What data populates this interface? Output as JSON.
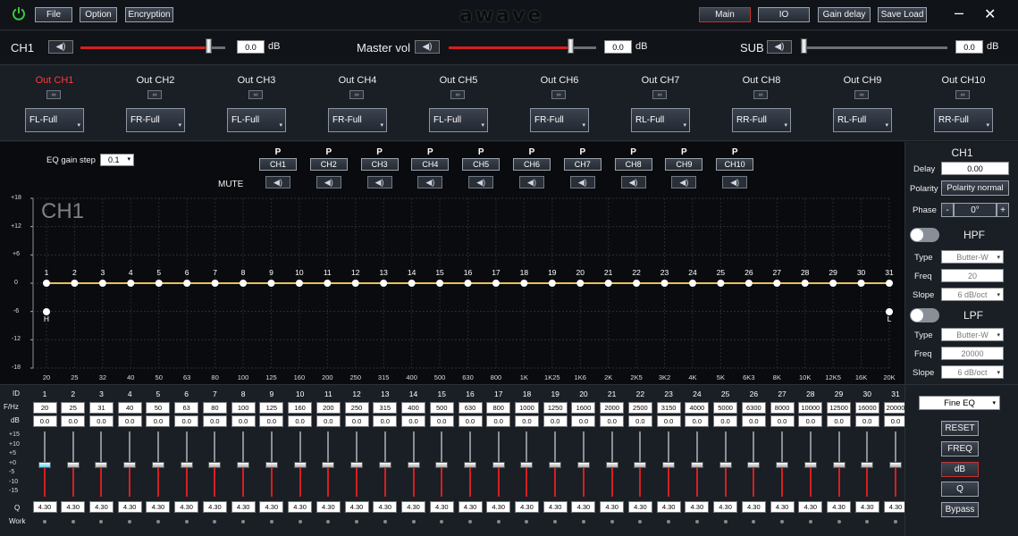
{
  "app": {
    "logo": "awave"
  },
  "menu": {
    "file": "File",
    "option": "Option",
    "encryption": "Encryption"
  },
  "nav": {
    "main": "Main",
    "io": "IO",
    "gain_delay": "Gain delay",
    "save_load": "Save Load"
  },
  "window": {
    "minimize": "–",
    "close": "✕"
  },
  "volume": {
    "ch1": {
      "label": "CH1",
      "value": "0.0",
      "unit": "dB",
      "level": 0.9
    },
    "master": {
      "label": "Master vol",
      "value": "0.0",
      "unit": "dB",
      "level": 0.84
    },
    "sub": {
      "label": "SUB",
      "value": "0.0",
      "unit": "dB",
      "level": 0.0
    }
  },
  "outputs": [
    {
      "label": "Out CH1",
      "mode": "FL-Full"
    },
    {
      "label": "Out CH2",
      "mode": "FR-Full"
    },
    {
      "label": "Out CH3",
      "mode": "FL-Full"
    },
    {
      "label": "Out CH4",
      "mode": "FR-Full"
    },
    {
      "label": "Out CH5",
      "mode": "FL-Full"
    },
    {
      "label": "Out CH6",
      "mode": "FR-Full"
    },
    {
      "label": "Out CH7",
      "mode": "RL-Full"
    },
    {
      "label": "Out CH8",
      "mode": "RR-Full"
    },
    {
      "label": "Out CH9",
      "mode": "RL-Full"
    },
    {
      "label": "Out CH10",
      "mode": "RR-Full"
    }
  ],
  "eq_settings": {
    "gain_step_label": "EQ gain step",
    "gain_step_value": "0.1",
    "mute_label": "MUTE",
    "phase_marker": "P"
  },
  "channel_buttons": [
    "CH1",
    "CH2",
    "CH3",
    "CH4",
    "CH5",
    "CH6",
    "CH7",
    "CH8",
    "CH9",
    "CH10"
  ],
  "graph": {
    "channel_title": "CH1",
    "y_ticks": [
      "+18",
      "+12",
      "+6",
      "0",
      "-6",
      "-12",
      "-18"
    ],
    "x_ticks": [
      "20",
      "25",
      "32",
      "40",
      "50",
      "63",
      "80",
      "100",
      "125",
      "160",
      "200",
      "250",
      "315",
      "400",
      "500",
      "630",
      "800",
      "1K",
      "1K25",
      "1K6",
      "2K",
      "2K5",
      "3K2",
      "4K",
      "5K",
      "6K3",
      "8K",
      "10K",
      "12K5",
      "16K",
      "20K"
    ],
    "hpf_marker": "H",
    "lpf_marker": "L",
    "line_color": "#e8c060"
  },
  "right_panel": {
    "title": "CH1",
    "delay_label": "Delay",
    "delay_value": "0.00",
    "polarity_label": "Polarity",
    "polarity_value": "Polarity normal",
    "phase_label": "Phase",
    "phase_minus": "-",
    "phase_value": "0°",
    "phase_plus": "+",
    "hpf": {
      "title": "HPF",
      "type_label": "Type",
      "type_value": "Butter-W",
      "freq_label": "Freq",
      "freq_value": "20",
      "slope_label": "Slope",
      "slope_value": "6 dB/oct"
    },
    "lpf": {
      "title": "LPF",
      "type_label": "Type",
      "type_value": "Butter-W",
      "freq_label": "Freq",
      "freq_value": "20000",
      "slope_label": "Slope",
      "slope_value": "6 dB/oct"
    }
  },
  "bands": {
    "row_labels": {
      "id": "ID",
      "freq": "F/Hz",
      "db": "dB",
      "q": "Q",
      "work": "Work"
    },
    "fader_scale": [
      "+15",
      "+10",
      "+5",
      "+0",
      "-5",
      "-10",
      "-15"
    ],
    "ids": [
      "1",
      "2",
      "3",
      "4",
      "5",
      "6",
      "7",
      "8",
      "9",
      "10",
      "11",
      "12",
      "13",
      "14",
      "15",
      "16",
      "17",
      "18",
      "19",
      "20",
      "21",
      "22",
      "23",
      "24",
      "25",
      "26",
      "27",
      "28",
      "29",
      "30",
      "31"
    ],
    "freqs": [
      "20",
      "25",
      "31",
      "40",
      "50",
      "63",
      "80",
      "100",
      "125",
      "160",
      "200",
      "250",
      "315",
      "400",
      "500",
      "630",
      "800",
      "1000",
      "1250",
      "1600",
      "2000",
      "2500",
      "3150",
      "4000",
      "5000",
      "6300",
      "8000",
      "10000",
      "12500",
      "16000",
      "20000"
    ],
    "gains": [
      "0.0",
      "0.0",
      "0.0",
      "0.0",
      "0.0",
      "0.0",
      "0.0",
      "0.0",
      "0.0",
      "0.0",
      "0.0",
      "0.0",
      "0.0",
      "0.0",
      "0.0",
      "0.0",
      "0.0",
      "0.0",
      "0.0",
      "0.0",
      "0.0",
      "0.0",
      "0.0",
      "0.0",
      "0.0",
      "0.0",
      "0.0",
      "0.0",
      "0.0",
      "0.0",
      "0.0"
    ],
    "q": [
      "4.30",
      "4.30",
      "4.30",
      "4.30",
      "4.30",
      "4.30",
      "4.30",
      "4.30",
      "4.30",
      "4.30",
      "4.30",
      "4.30",
      "4.30",
      "4.30",
      "4.30",
      "4.30",
      "4.30",
      "4.30",
      "4.30",
      "4.30",
      "4.30",
      "4.30",
      "4.30",
      "4.30",
      "4.30",
      "4.30",
      "4.30",
      "4.30",
      "4.30",
      "4.30",
      "4.30"
    ]
  },
  "bottom_panel": {
    "mode": "Fine EQ",
    "reset": "RESET",
    "freq": "FREQ",
    "db": "dB",
    "q": "Q",
    "bypass": "Bypass"
  },
  "colors": {
    "accent_red": "#d42020",
    "power_green": "#3ec43e"
  }
}
